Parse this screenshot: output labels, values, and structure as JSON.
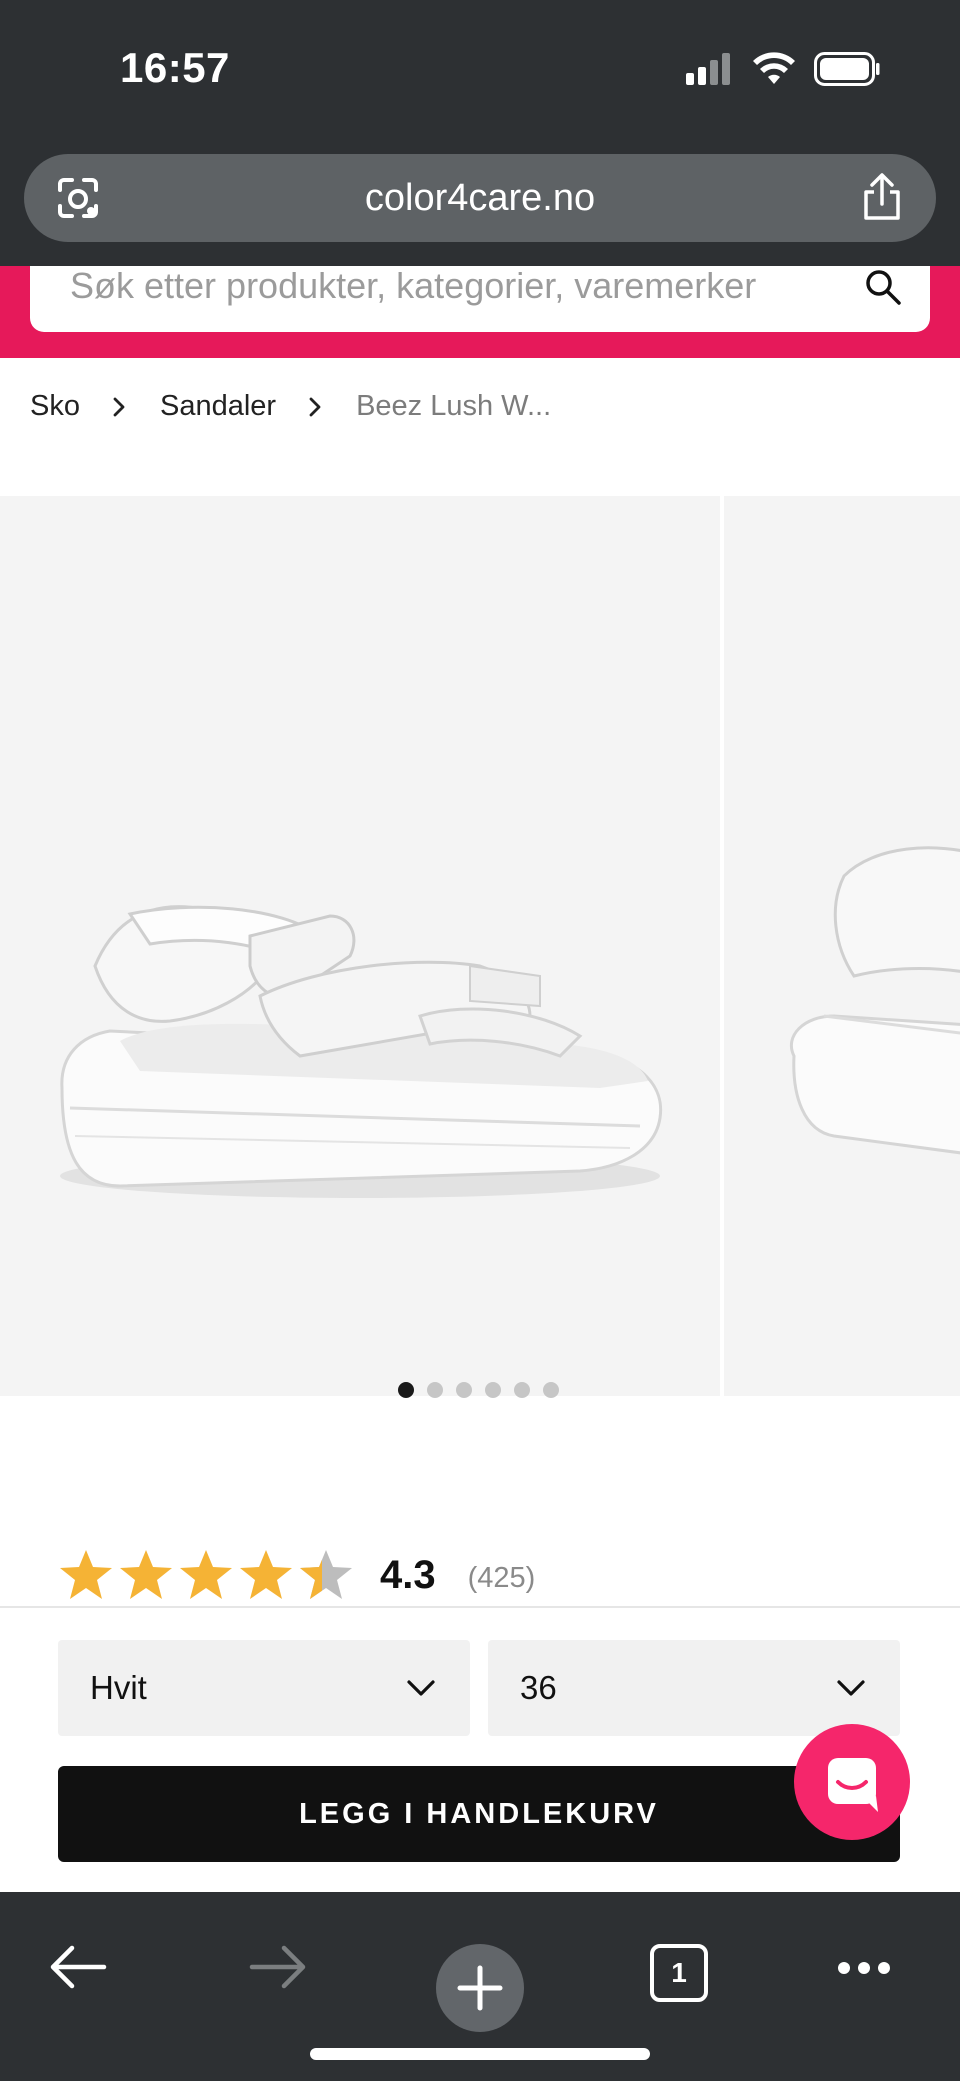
{
  "status_bar": {
    "time": "16:57"
  },
  "browser": {
    "url": "color4care.no",
    "tab_count": "1"
  },
  "search": {
    "placeholder": "Søk etter produkter, kategorier, varemerker"
  },
  "breadcrumb": {
    "items": [
      "Sko",
      "Sandaler"
    ],
    "current": "Beez Lush W..."
  },
  "gallery": {
    "image_count": 6,
    "active_index": 0
  },
  "rating": {
    "value": "4.3",
    "count": "(425)",
    "stars": 4.3
  },
  "purchase": {
    "color": "Hvit",
    "size": "36",
    "add_to_cart_label": "LEGG I HANDLEKURV"
  },
  "colors": {
    "brand_pink": "#e6195a",
    "chat_pink": "#f5266b",
    "chrome_dark": "#2d3033",
    "star_gold": "#f5b335"
  }
}
